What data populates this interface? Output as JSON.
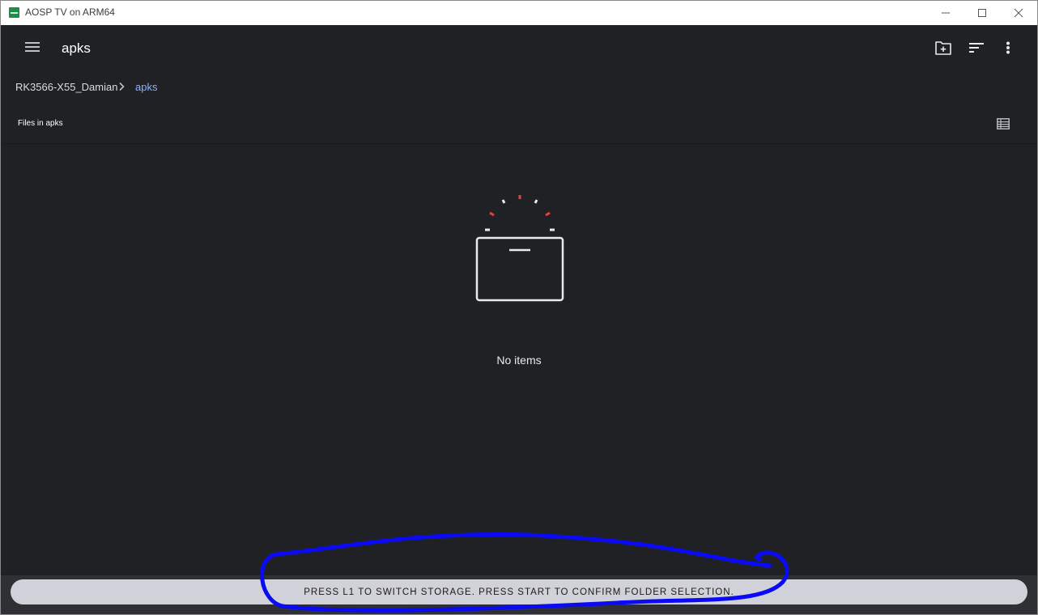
{
  "window": {
    "title": "AOSP TV on ARM64",
    "controls": [
      "minimize-icon",
      "maximize-icon",
      "close-icon"
    ]
  },
  "toolbar": {
    "menu_icon": "menu-icon",
    "title": "apks",
    "actions": [
      "new-folder-icon",
      "sort-icon",
      "more-vert-icon"
    ]
  },
  "breadcrumb": {
    "root": "RK3566-X55_Damian",
    "separator_icon": "chevron-right-icon",
    "current": "apks"
  },
  "section": {
    "label": "Files in apks",
    "view_toggle_icon": "list-view-icon"
  },
  "empty_state": {
    "icon": "empty-box-icon",
    "message": "No items"
  },
  "footer": {
    "hint": "PRESS L1 TO SWITCH STORAGE. PRESS START TO CONFIRM FOLDER SELECTION."
  },
  "colors": {
    "app_background": "#202124",
    "breadcrumb_active": "#8ab4f8",
    "hint_pill": "#d1d1d9",
    "annotation_stroke": "#0000ff",
    "spark_accent": "#e94235"
  }
}
